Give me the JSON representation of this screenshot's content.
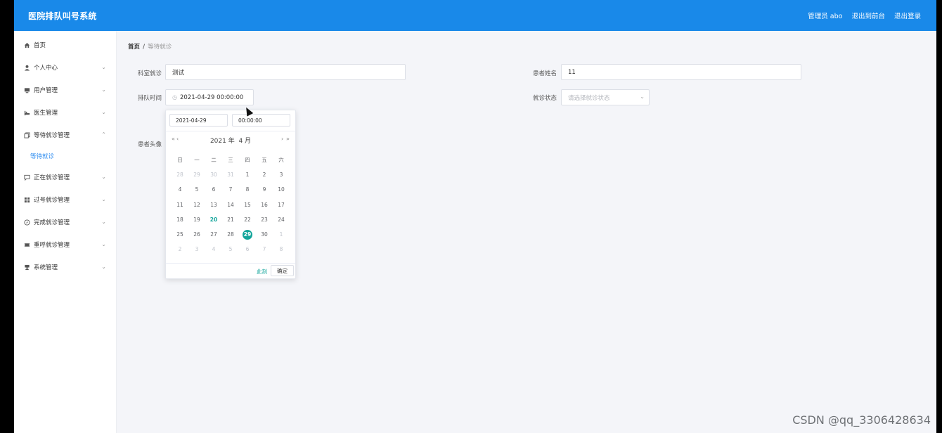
{
  "header": {
    "title": "医院排队叫号系统",
    "admin": "管理员 abo",
    "back_front": "退出到前台",
    "logout": "退出登录"
  },
  "sidebar": {
    "items": [
      {
        "label": "首页",
        "icon": "home-icon"
      },
      {
        "label": "个人中心",
        "icon": "user-icon"
      },
      {
        "label": "用户管理",
        "icon": "monitor-icon"
      },
      {
        "label": "医生管理",
        "icon": "bed-icon"
      },
      {
        "label": "等待就诊管理",
        "icon": "copy-icon"
      },
      {
        "label": "正在就诊管理",
        "icon": "message-icon"
      },
      {
        "label": "过号就诊管理",
        "icon": "grid-icon"
      },
      {
        "label": "完成就诊管理",
        "icon": "compass-icon"
      },
      {
        "label": "重呼就诊管理",
        "icon": "ticket-icon"
      },
      {
        "label": "系统管理",
        "icon": "settings-icon"
      }
    ],
    "submenu_active": "等待就诊"
  },
  "breadcrumb": {
    "home": "首页",
    "separator": "/",
    "current": "等待就诊"
  },
  "form": {
    "dept_label": "科室就诊",
    "dept_value": "测试",
    "patient_name_label": "患者姓名",
    "patient_name_value": "11",
    "queue_time_label": "排队时间",
    "queue_time_value": "2021-04-29 00:00:00",
    "status_label": "就诊状态",
    "status_placeholder": "请选择就诊状态",
    "avatar_label": "患者头像"
  },
  "datepicker": {
    "date_value": "2021-04-29",
    "time_value": "00:00:00",
    "prev_year": "«",
    "prev_month": "‹",
    "next_month": "›",
    "next_year": "»",
    "year_label": "2021 年",
    "month_label": "4 月",
    "weekdays": [
      "日",
      "一",
      "二",
      "三",
      "四",
      "五",
      "六"
    ],
    "weeks": [
      [
        "28",
        "29",
        "30",
        "31",
        "1",
        "2",
        "3"
      ],
      [
        "4",
        "5",
        "6",
        "7",
        "8",
        "9",
        "10"
      ],
      [
        "11",
        "12",
        "13",
        "14",
        "15",
        "16",
        "17"
      ],
      [
        "18",
        "19",
        "20",
        "21",
        "22",
        "23",
        "24"
      ],
      [
        "25",
        "26",
        "27",
        "28",
        "29",
        "30",
        "1"
      ],
      [
        "2",
        "3",
        "4",
        "5",
        "6",
        "7",
        "8"
      ]
    ],
    "today": "20",
    "selected": "29",
    "now_button": "此刻",
    "ok_button": "确定"
  },
  "watermark": "CSDN @qq_3306428634",
  "colors": {
    "header": "#1989e9",
    "accent": "#13a59b",
    "sidebar_active": "#2d8cf0"
  }
}
